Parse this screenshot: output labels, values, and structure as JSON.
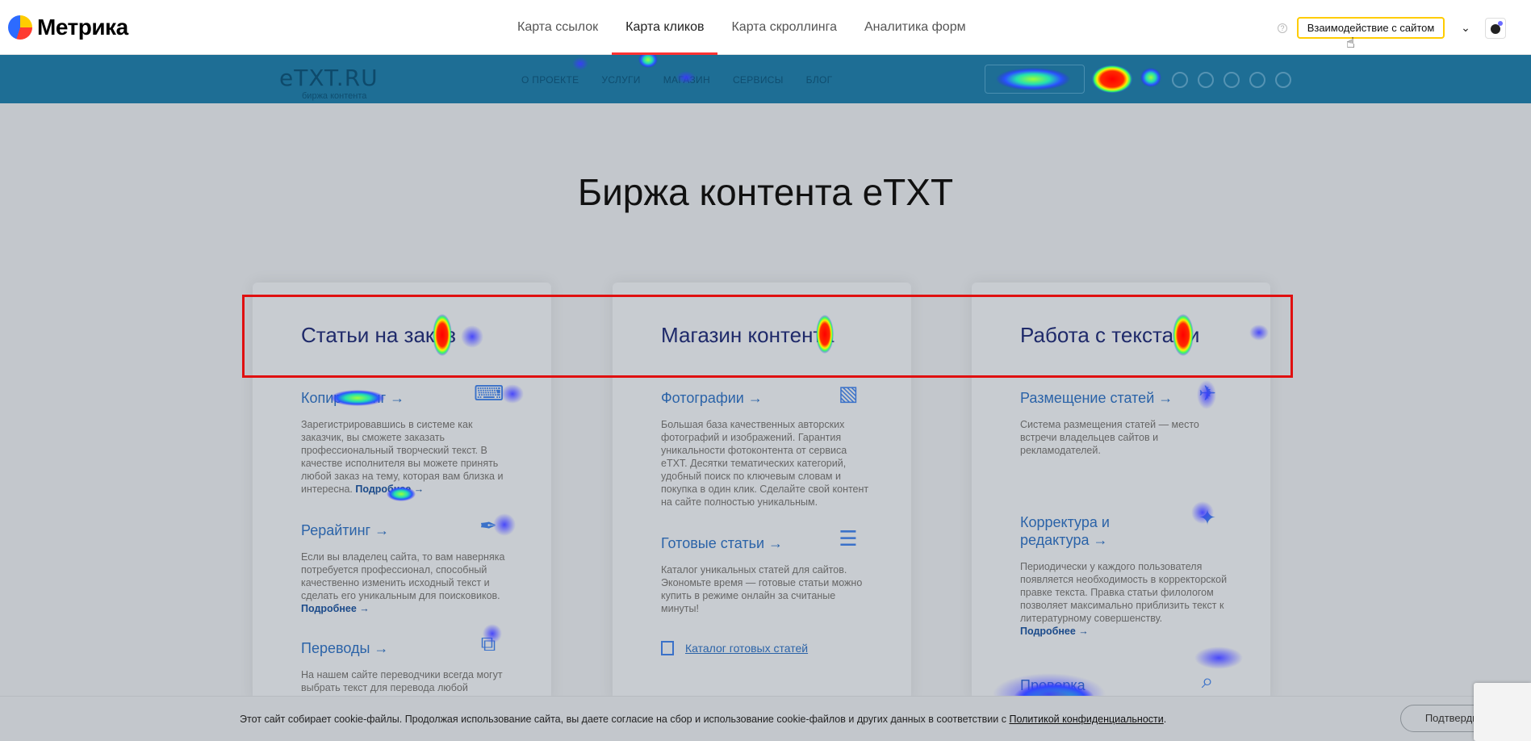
{
  "metrika": {
    "logo_text": "Метрика",
    "tabs": [
      {
        "label": "Карта ссылок",
        "active": false
      },
      {
        "label": "Карта кликов",
        "active": true
      },
      {
        "label": "Карта скроллинга",
        "active": false
      },
      {
        "label": "Аналитика форм",
        "active": false
      }
    ],
    "help_glyph": "?",
    "interaction_button": "Взаимодействие с сайтом",
    "accent_color": "#ffcc00",
    "active_tab_color": "#ff3333"
  },
  "site": {
    "logo": "eTXT.RU",
    "logo_sub": "биржа контента",
    "nav": [
      "О проекте",
      "Услуги",
      "Магазин",
      "Сервисы",
      "Блог"
    ],
    "heading": "Биржа контента eTXT"
  },
  "cards": [
    {
      "title": "Статьи на заказ",
      "items": [
        {
          "title": "Копирайтинг →",
          "icon": "typewriter-icon",
          "text": "Зарегистрировавшись в системе как заказчик, вы сможете заказать профессиональный творческий текст. В качестве исполнителя вы можете принять любой заказ на тему, которая вам близка и интересна.",
          "more": "Подробнее →"
        },
        {
          "title": "Рерайтинг →",
          "icon": "pen-icon",
          "text": "Если вы владелец сайта, то вам наверняка потребуется профессионал, способный качественно изменить исходный текст и сделать его уникальным для поисковиков.",
          "more": "Подробнее →"
        },
        {
          "title": "Переводы →",
          "icon": "translate-icon",
          "text": "На нашем сайте переводчики всегда могут выбрать текст для перевода любой",
          "more": ""
        }
      ]
    },
    {
      "title": "Магазин контента",
      "items": [
        {
          "title": "Фотографии →",
          "icon": "photos-icon",
          "text": "Большая база качественных авторских фотографий и изображений. Гарантия уникальности фотоконтента от сервиса eTXT. Десятки тематических категорий, удобный поиск по ключевым словам и покупка в один клик. Сделайте свой контент на сайте полностью уникальным.",
          "more": ""
        },
        {
          "title": "Готовые статьи →",
          "icon": "articles-icon",
          "text": "Каталог уникальных статей для сайтов. Экономьте время — готовые статьи можно купить в режиме онлайн за считаные минуты!",
          "more": ""
        }
      ],
      "catalog_link": "Каталог готовых статей"
    },
    {
      "title": "Работа с текстами",
      "items": [
        {
          "title": "Размещение статей →",
          "icon": "paper-plane-icon",
          "text": "Система размещения статей — место встречи владельцев сайтов и рекламодателей.",
          "more": ""
        },
        {
          "title": "Корректура и редактура →",
          "icon": "magic-wand-icon",
          "text": "Периодически у каждого пользователя появляется необходимость в корректорской правке текста. Правка статьи филологом позволяет максимально приблизить текст к литературному совершенству.",
          "more": "Подробнее →"
        },
        {
          "title": "Проверка",
          "icon": "magnifier-icon",
          "text": "",
          "more": ""
        }
      ]
    }
  ],
  "cookie": {
    "text": "Этот сайт собирает cookie-файлы. Продолжая использование сайта, вы даете согласие на сбор и использование cookie-файлов и других данных в соответствии с ",
    "link": "Политикой конфиденциальности",
    "tail": ".",
    "button": "Подтвердить"
  }
}
